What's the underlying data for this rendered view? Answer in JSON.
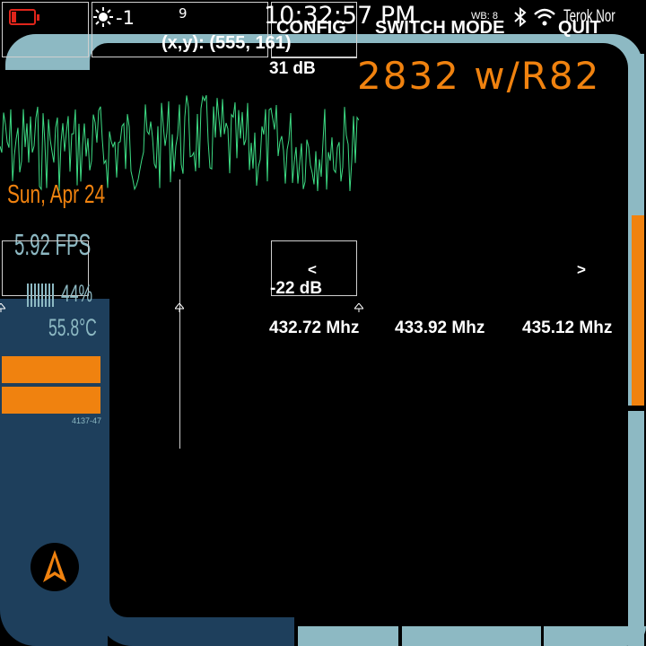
{
  "status_bar": {
    "battery_icon": "battery-low-icon",
    "brightness_icon": "sun-icon",
    "brightness_value": "-1",
    "volume_value": "9",
    "clock": "10:32:57 PM",
    "wb_label": "WB: 8",
    "bluetooth_icon": "bluetooth-icon",
    "wifi_icon": "wifi-icon",
    "network_name": "Terok Nor"
  },
  "menu": {
    "config": "CONFIG",
    "switch_mode": "SWITCH MODE",
    "quit": "QUIT"
  },
  "cursor_readout": "(x,y): (555, 161)",
  "title": "2832 w/R82",
  "spectrum": {
    "top_db": "31 dB",
    "bottom_db": "-22 dB",
    "prev_label": "<",
    "next_label": ">",
    "freq_labels": [
      "432.72 Mhz",
      "433.92 Mhz",
      "435.12 Mhz"
    ]
  },
  "sidebar": {
    "date": "Sun, Apr 24",
    "fps": "5.92 FPS",
    "cpu_percent": "44%",
    "temperature": "55.8°C",
    "code": "4137-47",
    "logo_icon": "starfleet-delta-icon"
  },
  "colors": {
    "accent": "#f0820f",
    "frame": "#8db9c3",
    "panel": "#1e3f5c",
    "waveform": "#3ddc84",
    "battery": "#e0251b"
  }
}
